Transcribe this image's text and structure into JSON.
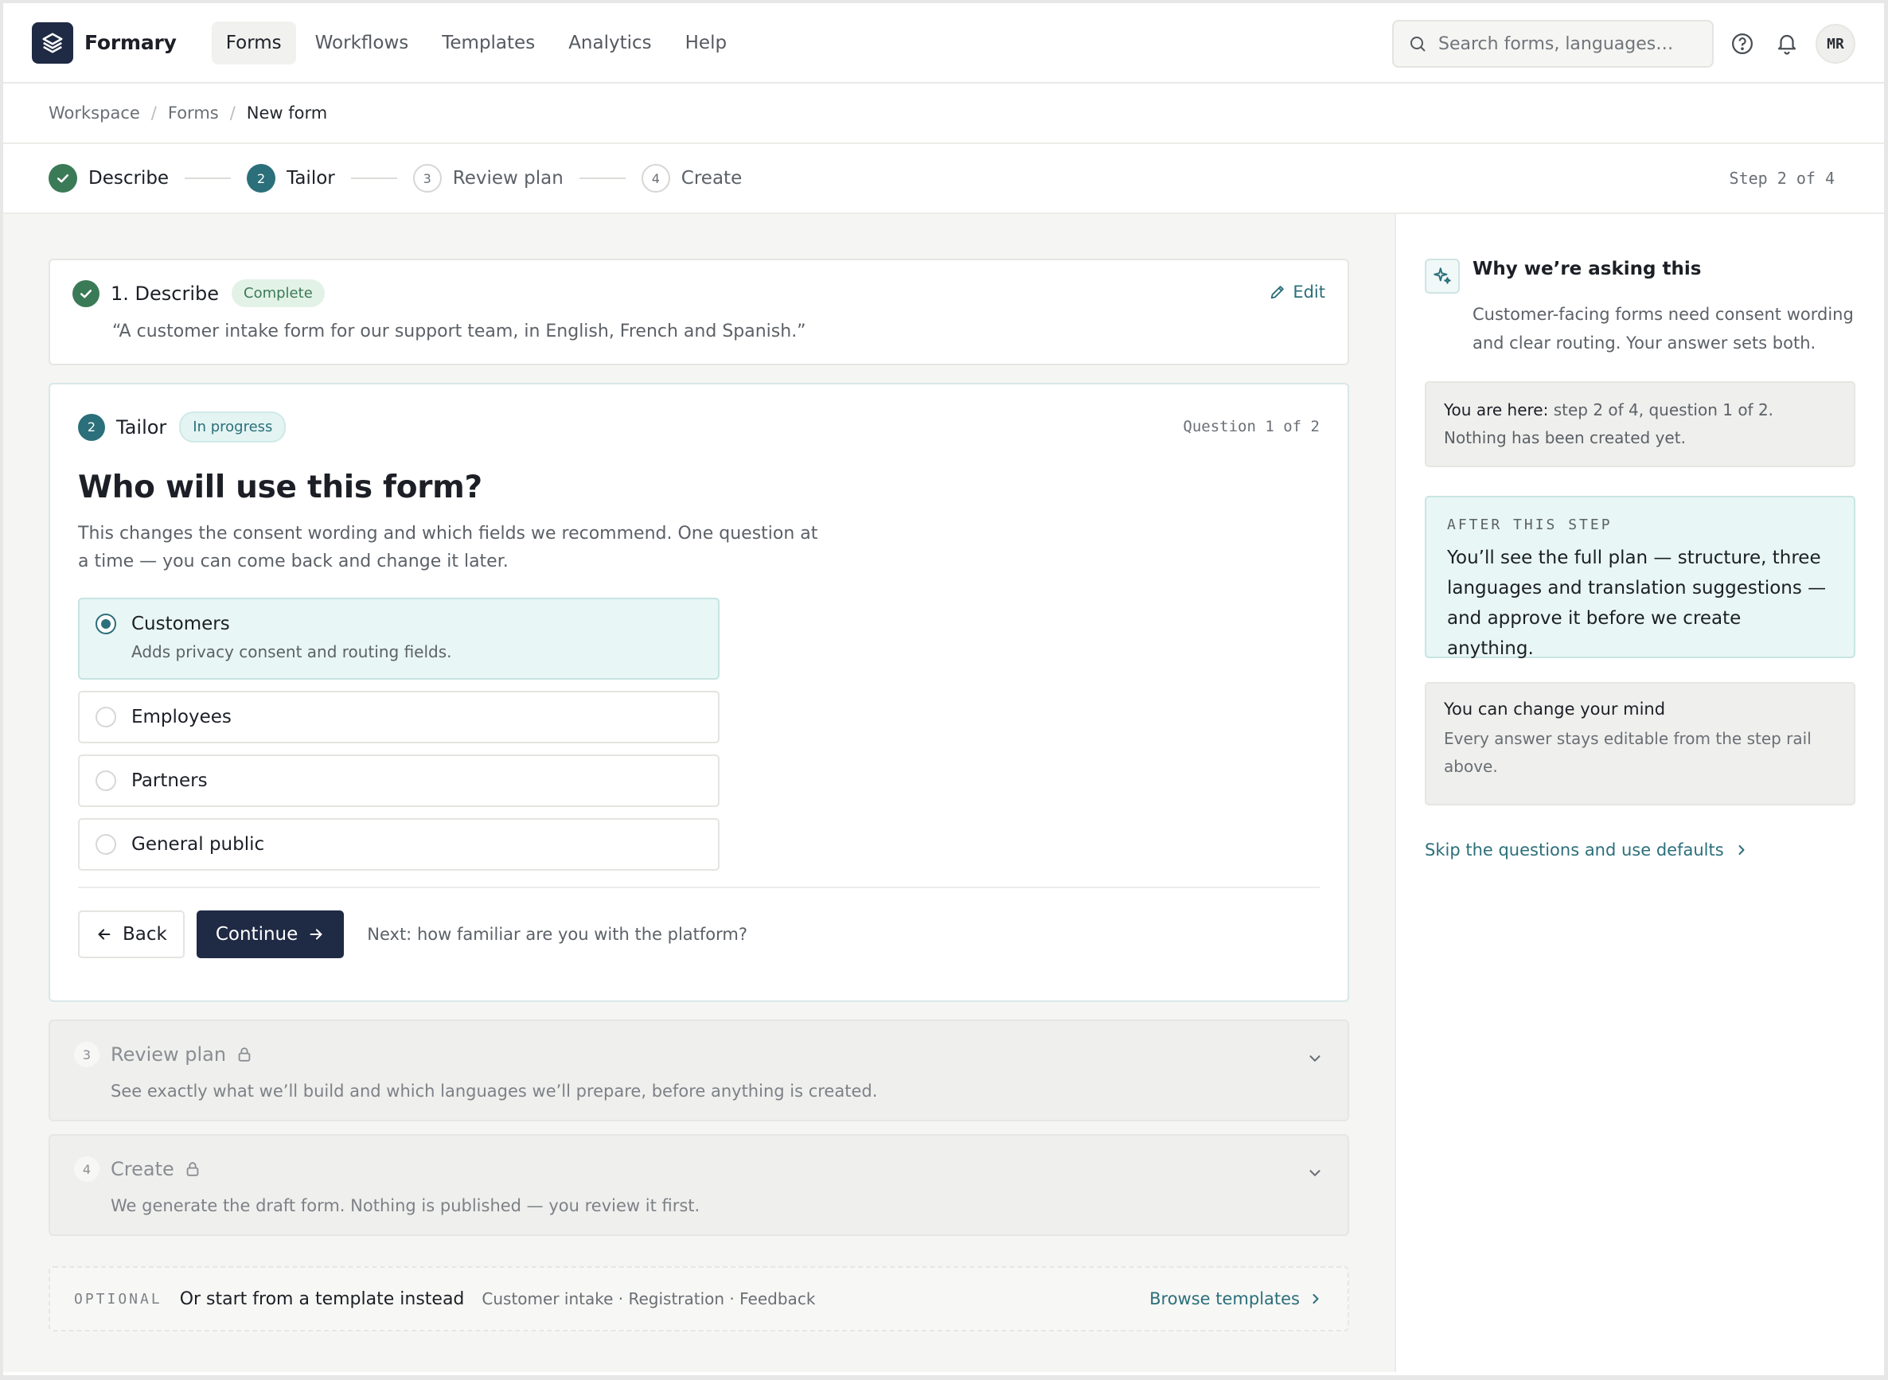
{
  "app": {
    "name": "Formary"
  },
  "nav": {
    "links": [
      "Forms",
      "Workflows",
      "Templates",
      "Analytics",
      "Help"
    ],
    "active": "Forms",
    "search_placeholder": "Search forms, languages…",
    "avatar_initials": "MR"
  },
  "breadcrumb": [
    "Workspace",
    "Forms",
    "New form"
  ],
  "stepper": {
    "steps": [
      {
        "num": "1",
        "label": "Describe",
        "state": "done"
      },
      {
        "num": "2",
        "label": "Tailor",
        "state": "current"
      },
      {
        "num": "3",
        "label": "Review plan",
        "state": "todo"
      },
      {
        "num": "4",
        "label": "Create",
        "state": "todo"
      }
    ],
    "count": "Step 2 of 4"
  },
  "describe": {
    "title": "1. Describe",
    "badge": "Complete",
    "edit": "Edit",
    "quote": "“A customer intake form for our support team, in English, French and Spanish.”"
  },
  "tailor": {
    "num": "2",
    "title": "Tailor",
    "badge": "In progress",
    "qcount": "Question 1 of 2",
    "question": "Who will use this form?",
    "description": "This changes the consent wording and which fields we recommend. One question at a time — you can come back and change it later.",
    "options": [
      {
        "label": "Customers",
        "sub": "Adds privacy consent and routing fields.",
        "selected": true
      },
      {
        "label": "Employees"
      },
      {
        "label": "Partners"
      },
      {
        "label": "General public"
      }
    ],
    "back": "Back",
    "continue": "Continue",
    "next_hint": "Next: how familiar are you with the platform?"
  },
  "locked": [
    {
      "num": "3",
      "title": "Review plan",
      "desc": "See exactly what we’ll build and which languages we’ll prepare, before anything is created."
    },
    {
      "num": "4",
      "title": "Create",
      "desc": "We generate the draft form. Nothing is published — you review it first."
    }
  ],
  "optional": {
    "tag": "OPTIONAL",
    "title": "Or start from a template instead",
    "list": "Customer intake · Registration · Feedback",
    "link": "Browse templates"
  },
  "side": {
    "why_title": "Why we’re asking this",
    "why_body": "Customer-facing forms need consent wording and clear routing. Your answer sets both.",
    "here_label": "You are here:",
    "here_text": " step 2 of 4, question 1 of 2. Nothing has been created yet.",
    "after_tag": "AFTER THIS STEP",
    "after_body": "You’ll see the full plan — structure, three languages and translation suggestions — and approve it before we create anything.",
    "mind_title": "You can change your mind",
    "mind_body": "Every answer stays editable from the step rail above.",
    "skip": "Skip the questions and use defaults"
  },
  "colors": {
    "accent": "#2b6f7a",
    "navy": "#1f2a44",
    "success": "#3b7a57"
  }
}
